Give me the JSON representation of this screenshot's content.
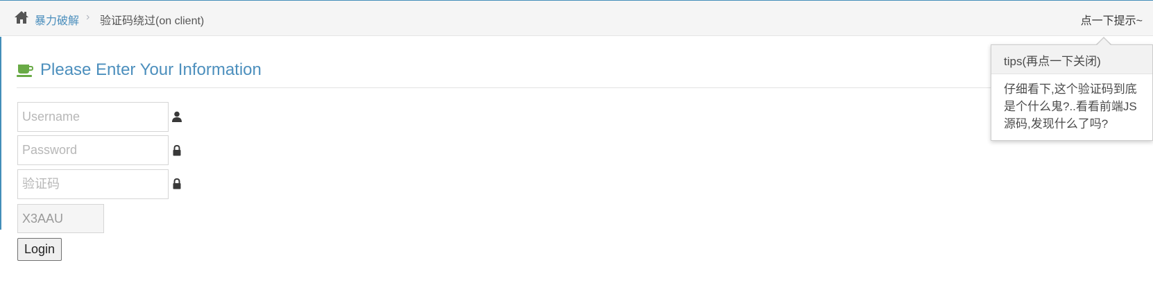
{
  "breadcrumbs": {
    "home_icon": "home-icon",
    "link": "暴力破解",
    "separator": "›",
    "current": "验证码绕过(on client)"
  },
  "hint_link": "点一下提示~",
  "header": {
    "icon": "coffee-icon",
    "title": "Please Enter Your Information",
    "accent_color": "#4c8fbd",
    "icon_color": "#69aa46"
  },
  "form": {
    "username_placeholder": "Username",
    "password_placeholder": "Password",
    "captcha_placeholder": "验证码",
    "captcha_code": "X3AAU",
    "login_label": "Login"
  },
  "popover": {
    "title": "tips(再点一下关闭)",
    "content": "仔细看下,这个验证码到底是个什么鬼?..看看前端JS源码,发现什么了吗?"
  }
}
